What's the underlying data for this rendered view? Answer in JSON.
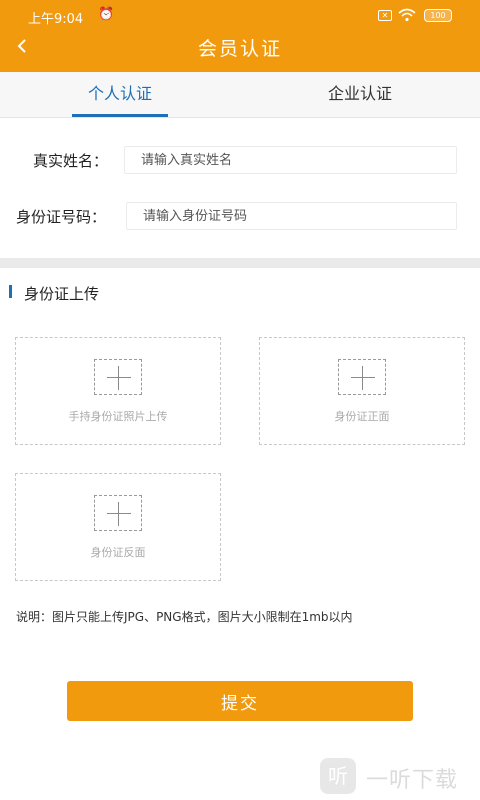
{
  "status_bar": {
    "time": "上午9:04",
    "alarm_icon": "alarm-off-icon",
    "sim_icon": "sim-icon",
    "wifi_icon": "wifi-icon",
    "battery": "100"
  },
  "nav": {
    "back_icon": "chevron-left-icon",
    "title": "会员认证"
  },
  "tabs": [
    {
      "label": "个人认证",
      "active": true
    },
    {
      "label": "企业认证",
      "active": false
    }
  ],
  "form": {
    "name_label": "真实姓名：",
    "name_placeholder": "请输入真实姓名",
    "id_label": "身份证号码：",
    "id_placeholder": "请输入身份证号码"
  },
  "upload": {
    "section_title": "身份证上传",
    "slots": [
      {
        "label": "手持身份证照片上传"
      },
      {
        "label": "身份证正面"
      },
      {
        "label": "身份证反面"
      }
    ]
  },
  "note": "说明：图片只能上传JPG、PNG格式，图片大小限制在1mb以内",
  "submit_label": "提交",
  "watermark": {
    "logo_text": "听",
    "text": "一听下载"
  },
  "colors": {
    "brand_orange": "#f29a0e",
    "accent_blue": "#1e6fb8"
  }
}
